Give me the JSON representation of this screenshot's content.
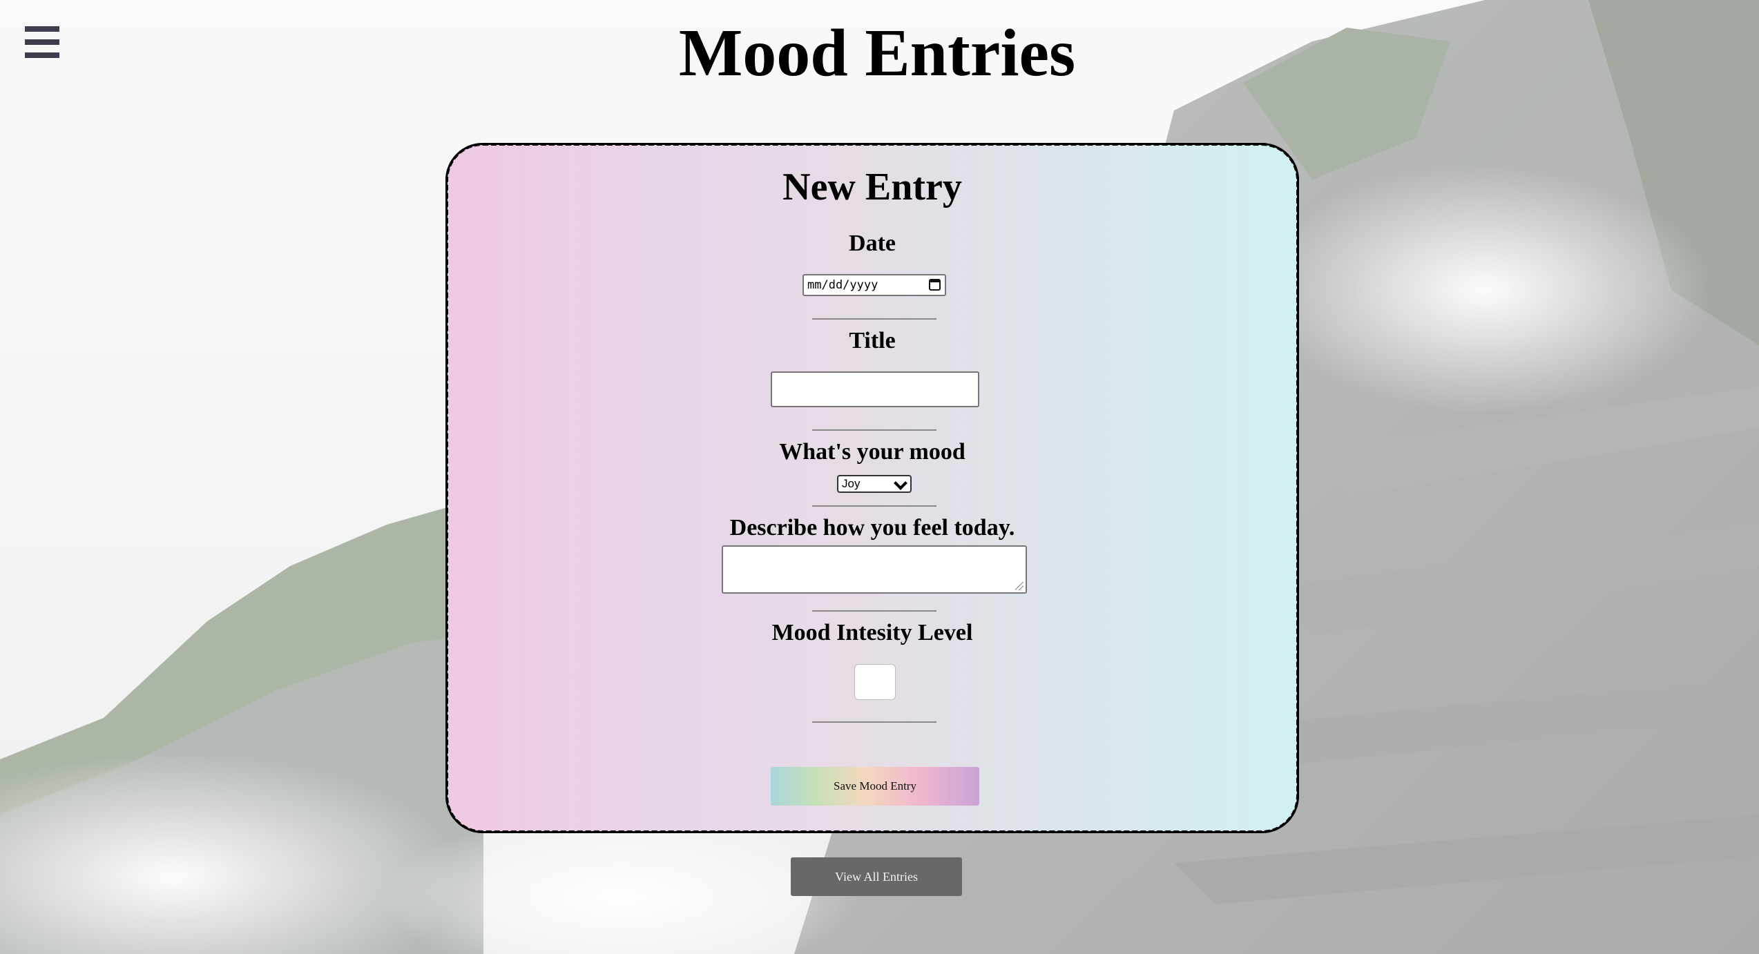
{
  "header": {
    "title": "Mood Entries",
    "menu_icon": "hamburger-menu-icon"
  },
  "form": {
    "heading": "New Entry",
    "date": {
      "label": "Date",
      "placeholder": "mm/dd/yyyy",
      "icon": "calendar-icon"
    },
    "title": {
      "label": "Title",
      "value": ""
    },
    "mood": {
      "label": "What's your mood",
      "selected": "Joy",
      "icon": "chevron-down-icon"
    },
    "feeling": {
      "label": "Describe how you feel today.",
      "value": ""
    },
    "intensity": {
      "label": "Mood Intesity Level",
      "value": ""
    },
    "save_label": "Save Mood Entry"
  },
  "footer": {
    "view_all_label": "View All Entries"
  },
  "colors": {
    "card_gradient_start": "#efc8e3",
    "card_gradient_end": "#d2f1f1",
    "view_button": "#686868",
    "menu_icon": "#3d3d4d"
  }
}
